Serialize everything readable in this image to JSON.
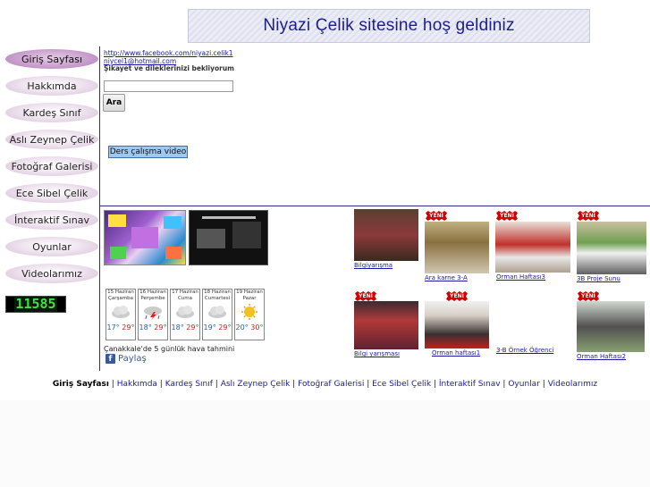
{
  "banner": {
    "title": "Niyazi Çelik sitesine hoş geldiniz"
  },
  "nav": [
    {
      "label": "Giriş Sayfası",
      "active": true
    },
    {
      "label": "Hakkımda"
    },
    {
      "label": "Kardeş Sınıf"
    },
    {
      "label": "Aslı Zeynep Çelik"
    },
    {
      "label": "Fotoğraf Galerisi"
    },
    {
      "label": "Ece Sibel Çelik"
    },
    {
      "label": "İnteraktif Sınav"
    },
    {
      "label": "Oyunlar"
    },
    {
      "label": "Videolarımız"
    }
  ],
  "counter": {
    "value": "11585"
  },
  "contact": {
    "facebook": "http://www.facebook.com/niyazi.celik1",
    "email": "niycel1@hotmail.com",
    "note": "Şikayet ve dileklerinizi bekliyorum"
  },
  "search": {
    "value": "",
    "placeholder": "",
    "button": "Ara"
  },
  "video_button": "Ders çalışma video",
  "gallery": {
    "badge": "YENİ",
    "captions": {
      "bilgiyarisma": "Bilgiyarışma",
      "ara_karne": "Ara karne 3-A",
      "orman3": "Orman Haftası3",
      "proje": "3B Proje Sunu",
      "bilgi_yarismasi": "Bilgi yarışması",
      "orman1": "Orman haftası1",
      "ornek": "3-B Örnek Öğrenci",
      "orman2": "Orman Haftası2"
    }
  },
  "weather": {
    "days": [
      {
        "date": "15 Haziran",
        "day": "Çarşamba",
        "lo": "17°",
        "hi": "29°",
        "icon": "cloud-icon"
      },
      {
        "date": "16 Haziran",
        "day": "Perşembe",
        "lo": "18°",
        "hi": "29°",
        "icon": "thunderstorm-icon"
      },
      {
        "date": "17 Haziran",
        "day": "Cuma",
        "lo": "18°",
        "hi": "29°",
        "icon": "cloud-icon"
      },
      {
        "date": "18 Haziran",
        "day": "Cumartesi",
        "lo": "19°",
        "hi": "29°",
        "icon": "cloud-icon"
      },
      {
        "date": "19 Haziran",
        "day": "Pazar",
        "lo": "20°",
        "hi": "30°",
        "icon": "sun-icon"
      }
    ],
    "caption": "Çanakkale'de 5 günlük hava tahmini"
  },
  "share": {
    "label": "Paylaş"
  },
  "footer": {
    "links": [
      "Giriş Sayfası",
      "Hakkımda",
      "Kardeş Sınıf",
      "Aslı Zeynep Çelik",
      "Fotoğraf Galerisi",
      "Ece Sibel Çelik",
      "İnteraktif Sınav",
      "Oyunlar",
      "Videolarımız"
    ],
    "separator": "|"
  },
  "colors": {
    "accent": "#2c2c8a",
    "link": "#1a1aa0",
    "nav_active": "#c79bcb",
    "badge": "#d40000",
    "counter_digits": "#3fe23f"
  }
}
